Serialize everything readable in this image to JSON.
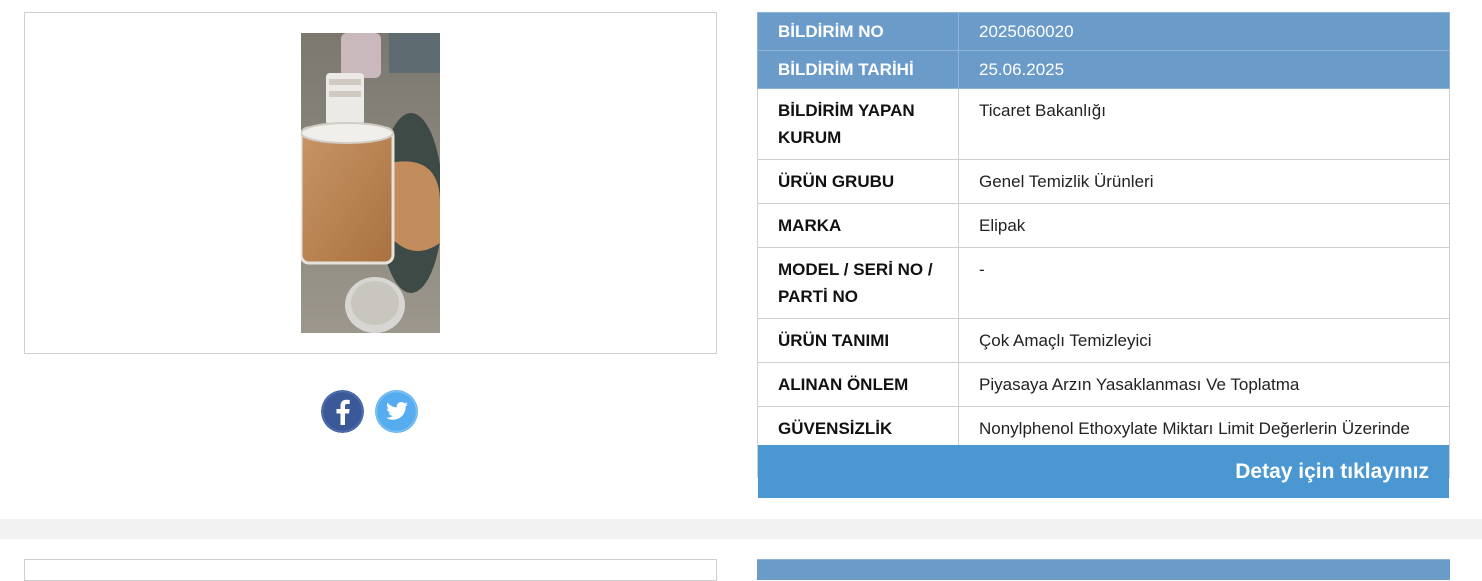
{
  "notice": {
    "rows": [
      {
        "label": "BİLDİRİM NO",
        "value": "2025060020",
        "highlight": true
      },
      {
        "label": "BİLDİRİM TARİHİ",
        "value": "25.06.2025",
        "highlight": true
      },
      {
        "label": "BİLDİRİM YAPAN KURUM",
        "value": "Ticaret Bakanlığı"
      },
      {
        "label": "ÜRÜN GRUBU",
        "value": "Genel Temizlik Ürünleri"
      },
      {
        "label": "MARKA",
        "value": "Elipak"
      },
      {
        "label": "MODEL / SERİ NO / PARTİ NO",
        "value": "-"
      },
      {
        "label": "ÜRÜN TANIMI",
        "value": "Çok Amaçlı Temizleyici"
      },
      {
        "label": "ALINAN ÖNLEM",
        "value": "Piyasaya Arzın Yasaklanması Ve Toplatma"
      },
      {
        "label": "GÜVENSİZLİK NEDENİ",
        "value": "Nonylphenol Ethoxylate Miktarı Limit Değerlerin Üzerinde Çıkmıştır."
      }
    ],
    "detail_button": "Detay için tıklayınız"
  },
  "social": {
    "facebook_icon": "facebook-icon",
    "twitter_icon": "twitter-icon"
  },
  "colors": {
    "header_row": "#6a9bc9",
    "button": "#4b97d2",
    "facebook": "#3b5998",
    "twitter": "#55acee"
  }
}
